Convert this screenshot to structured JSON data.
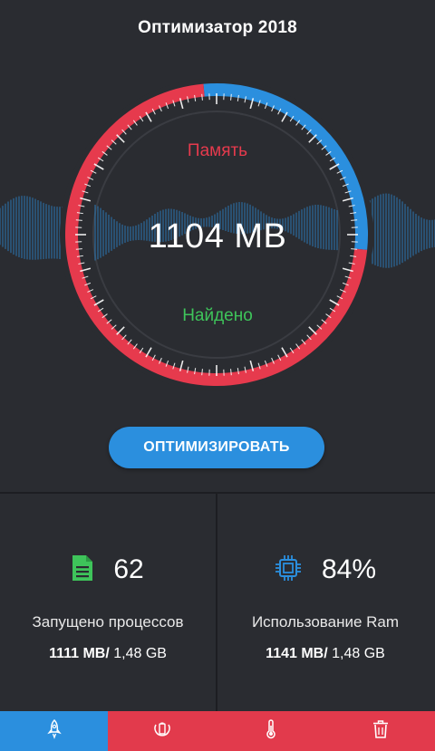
{
  "header": {
    "title": "Оптимизатор 2018"
  },
  "gauge": {
    "memory_label": "Память",
    "value_label": "1104 MB",
    "found_label": "Найдено",
    "red_fraction": 0.72,
    "colors": {
      "red": "#e63a4d",
      "blue": "#2b8fde",
      "wave": "#2b8fde"
    }
  },
  "optimize_button": {
    "label": "ОПТИМИЗИРОВАТЬ"
  },
  "stats": {
    "processes": {
      "icon": "document-icon",
      "count": "62",
      "caption": "Запущено процессов",
      "used": "1111 MB/",
      "total": " 1,48 GB"
    },
    "ram": {
      "icon": "chip-icon",
      "percent": "84%",
      "caption": "Использование Ram",
      "used": "1141 MB/",
      "total": " 1,48 GB"
    }
  },
  "bottom_nav": {
    "tabs": [
      {
        "icon": "rocket-icon",
        "active": true
      },
      {
        "icon": "battery-icon",
        "active": false
      },
      {
        "icon": "thermometer-icon",
        "active": false
      },
      {
        "icon": "trash-icon",
        "active": false
      }
    ]
  }
}
